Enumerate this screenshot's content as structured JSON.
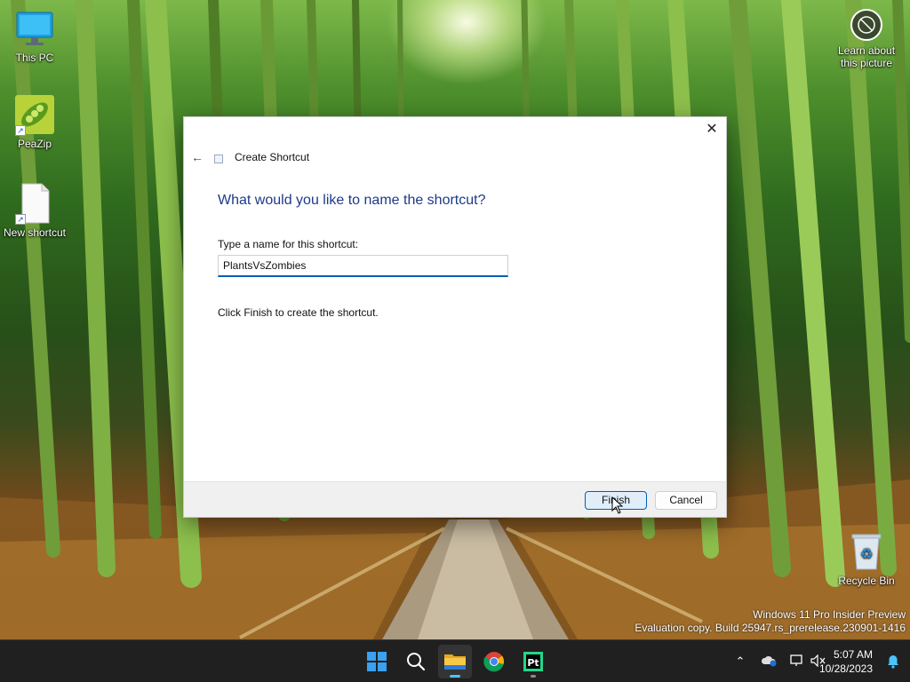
{
  "desktop": {
    "icons": [
      {
        "label": "This PC"
      },
      {
        "label": "PeaZip"
      },
      {
        "label": "New shortcut"
      },
      {
        "label": "Recycle Bin"
      }
    ],
    "learn_label": "Learn about this picture",
    "watermark_line1": "Windows 11 Pro Insider Preview",
    "watermark_line2": "Evaluation copy. Build 25947.rs_prerelease.230901-1416"
  },
  "dialog": {
    "title": "Create Shortcut",
    "heading": "What would you like to name the shortcut?",
    "name_label": "Type a name for this shortcut:",
    "name_value": "PlantsVsZombies",
    "instruction": "Click Finish to create the shortcut.",
    "finish_label": "Finish",
    "cancel_label": "Cancel",
    "close_glyph": "✕",
    "back_glyph": "←"
  },
  "taskbar": {
    "apps": [
      "start-icon",
      "search-icon",
      "file-explorer-icon",
      "chrome-icon",
      "pycharm-icon"
    ],
    "pycharm_text": "Pt",
    "time": "5:07 AM",
    "date": "10/28/2023"
  },
  "colors": {
    "accent": "#005fb8",
    "heading": "#1c3a8a",
    "taskbar": "#202020"
  }
}
